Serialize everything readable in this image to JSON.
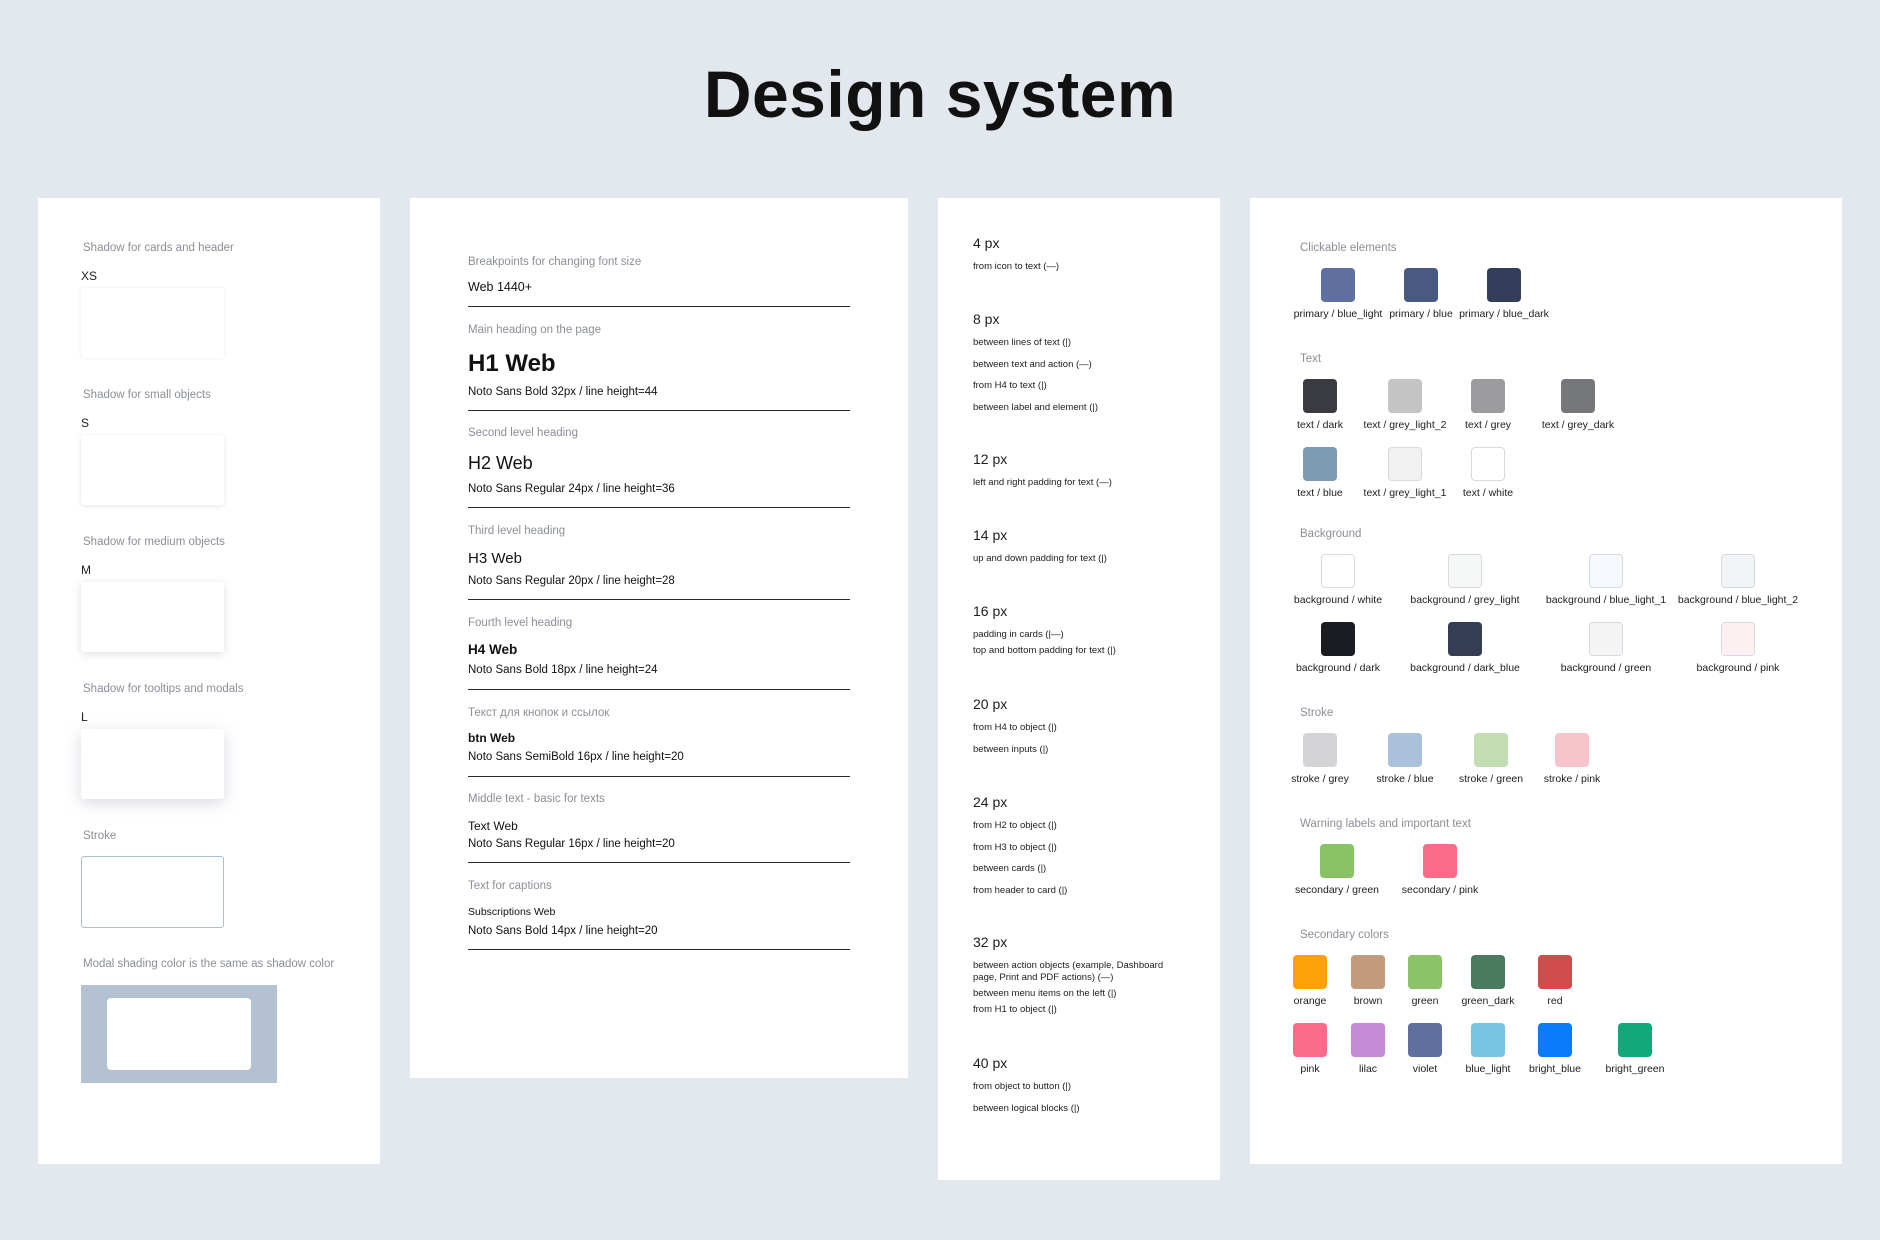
{
  "title": "Design system",
  "shadows": {
    "xs_label": "Shadow for cards and header",
    "xs_size": "XS",
    "s_label": "Shadow for small objects",
    "s_size": "S",
    "m_label": "Shadow for medium objects",
    "m_size": "M",
    "l_label": "Shadow for tooltips and modals",
    "l_size": "L",
    "stroke_label": "Stroke",
    "modal_label": "Modal shading color is the same as shadow color",
    "stroke_color": "#a8c0d8",
    "modal_shade_color": "#b3c1d2"
  },
  "typography": {
    "breakpoint_label": "Breakpoints for changing font size",
    "breakpoint_value": "Web 1440+",
    "h1_label": "Main heading on the page",
    "h1_sample": "H1 Web",
    "h1_spec": "Noto Sans Bold 32px / line height=44",
    "h2_label": "Second level heading",
    "h2_sample": "H2 Web",
    "h2_spec": "Noto Sans Regular 24px / line height=36",
    "h3_label": "Third level heading",
    "h3_sample": "H3 Web",
    "h3_spec": "Noto Sans Regular 20px / line height=28",
    "h4_label": "Fourth level heading",
    "h4_sample": "H4 Web",
    "h4_spec": "Noto Sans Bold 18px / line height=24",
    "btn_label": "Текст для кнопок и ссылок",
    "btn_sample": "btn Web",
    "btn_spec": "Noto Sans SemiBold 16px / line height=20",
    "text_label": "Middle text - basic for texts",
    "text_sample": "Text Web",
    "text_spec": "Noto Sans Regular 16px / line height=20",
    "caption_label": "Text for captions",
    "caption_sample": "Subscriptions Web",
    "caption_spec": "Noto Sans Bold 14px / line height=20"
  },
  "spacing": [
    {
      "value": "4 px",
      "items": [
        "from icon to text (—)"
      ]
    },
    {
      "value": "8 px",
      "items": [
        "between lines of text (|)",
        "between text and action (—)",
        "from H4 to text (|)",
        "between label and element (|)"
      ]
    },
    {
      "value": "12 px",
      "items": [
        "left and right padding for text (—)"
      ]
    },
    {
      "value": "14 px",
      "items": [
        "up and down padding for text (|)"
      ]
    },
    {
      "value": "16 px",
      "items": [
        "padding in cards  (|—)",
        "top and bottom padding for text (|)"
      ]
    },
    {
      "value": "20 px",
      "items": [
        "from H4 to object (|)",
        "between inputs (|)"
      ]
    },
    {
      "value": "24 px",
      "items": [
        "from H2 to object (|)",
        "from H3 to object (|)",
        "between cards (|)",
        "from header to card (|)"
      ]
    },
    {
      "value": "32 px",
      "items": [
        "between action objects (example, Dashboard page, Print and PDF actions) (—)",
        "between menu items on the left (|)",
        "from H1 to object (|)"
      ]
    },
    {
      "value": "40 px",
      "items": [
        "from object to button (|)",
        "between logical blocks (|)"
      ]
    }
  ],
  "colors": {
    "clickable_label": "Clickable elements",
    "clickable": [
      {
        "name": "primary / blue_light",
        "hex": "#5f6f9f"
      },
      {
        "name": "primary / blue",
        "hex": "#495a80"
      },
      {
        "name": "primary / blue_dark",
        "hex": "#333c58"
      }
    ],
    "text_label": "Text",
    "text": [
      {
        "name": "text / dark",
        "hex": "#3a3b42"
      },
      {
        "name": "text / grey_light_2",
        "hex": "#c4c4c4"
      },
      {
        "name": "text / grey",
        "hex": "#9c9c9e"
      },
      {
        "name": "text / grey_dark",
        "hex": "#76777a"
      },
      {
        "name": "text / blue",
        "hex": "#7f9ab3"
      },
      {
        "name": "text / grey_light_1",
        "hex": "#f1f1f1"
      },
      {
        "name": "text / white",
        "hex": "#ffffff"
      }
    ],
    "background_label": "Background",
    "background": [
      {
        "name": "background / white",
        "hex": "#ffffff"
      },
      {
        "name": "background / grey_light",
        "hex": "#f6f7f7"
      },
      {
        "name": "background / blue_light_1",
        "hex": "#f5f8fd"
      },
      {
        "name": "background / blue_light_2",
        "hex": "#f1f4f5"
      },
      {
        "name": "background / dark",
        "hex": "#1b1c22"
      },
      {
        "name": "background / dark_blue",
        "hex": "#353c56"
      },
      {
        "name": "background / green",
        "hex": "#f3f4f3"
      },
      {
        "name": "background / pink",
        "hex": "#fdf0f3"
      }
    ],
    "stroke_label": "Stroke",
    "stroke": [
      {
        "name": "stroke / grey",
        "hex": "#d4d4d6"
      },
      {
        "name": "stroke / blue",
        "hex": "#a9c1db"
      },
      {
        "name": "stroke / green",
        "hex": "#c1ddb1"
      },
      {
        "name": "stroke / pink",
        "hex": "#f8c4cc"
      }
    ],
    "warning_label": "Warning labels and important text",
    "warning": [
      {
        "name": "secondary / green",
        "hex": "#89c264"
      },
      {
        "name": "secondary / pink",
        "hex": "#fc6c8a"
      }
    ],
    "secondary_label": "Secondary colors",
    "secondary": [
      {
        "name": "orange",
        "hex": "#ffa20a"
      },
      {
        "name": "brown",
        "hex": "#c19b7c"
      },
      {
        "name": "green",
        "hex": "#8dc368"
      },
      {
        "name": "green_dark",
        "hex": "#4c7c60"
      },
      {
        "name": "red",
        "hex": "#cf4c4b"
      },
      {
        "name": "pink",
        "hex": "#fc6c8a"
      },
      {
        "name": "lilac",
        "hex": "#c48ad6"
      },
      {
        "name": "violet",
        "hex": "#5f6f9f"
      },
      {
        "name": "blue_light",
        "hex": "#78c4e4"
      },
      {
        "name": "bright_blue",
        "hex": "#0a7bfa"
      },
      {
        "name": "bright_green",
        "hex": "#11a97a"
      }
    ]
  }
}
